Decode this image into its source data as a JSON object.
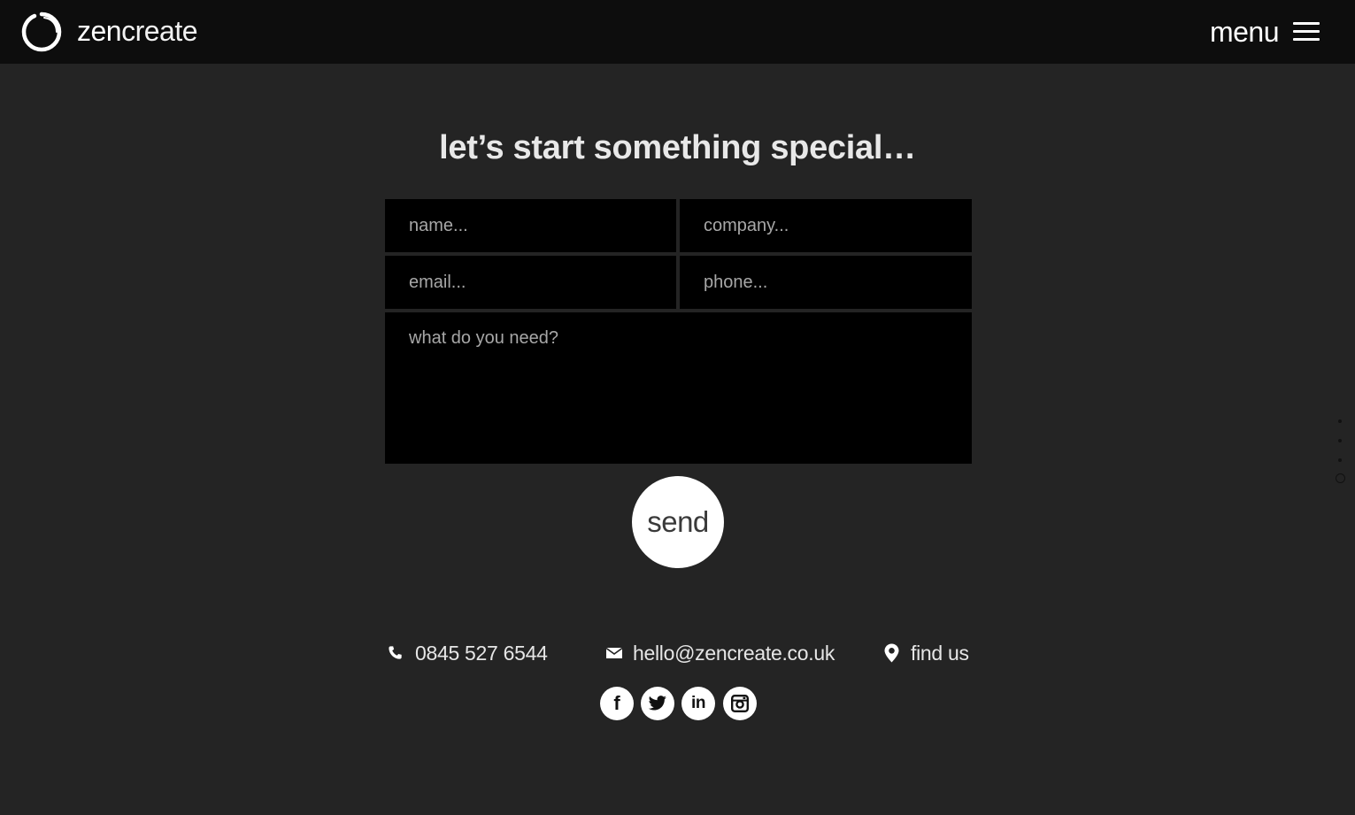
{
  "brand": {
    "name_bold": "zen",
    "name_light": "create"
  },
  "nav": {
    "menu_label": "menu"
  },
  "contact_form": {
    "heading": "let’s start something special…",
    "name_placeholder": "name...",
    "company_placeholder": "company...",
    "email_placeholder": "email...",
    "phone_placeholder": "phone...",
    "message_placeholder": "what do you need?",
    "send_label": "send"
  },
  "contact_info": {
    "phone": "0845 527 6544",
    "email": "hello@zencreate.co.uk",
    "location_label": "find us"
  },
  "social": [
    {
      "network": "facebook",
      "icon": "facebook-icon",
      "glyph": "f"
    },
    {
      "network": "twitter",
      "icon": "twitter-icon",
      "glyph": ""
    },
    {
      "network": "linkedin",
      "icon": "linkedin-icon",
      "glyph": "in"
    },
    {
      "network": "instagram",
      "icon": "instagram-icon",
      "glyph": ""
    }
  ],
  "page_indicator": {
    "total": 4,
    "active_index": 3
  },
  "colors": {
    "background": "#242424",
    "topbar": "#0d0d0d",
    "field_background": "#000000",
    "placeholder": "#a7a7a7",
    "text": "#ffffff"
  }
}
